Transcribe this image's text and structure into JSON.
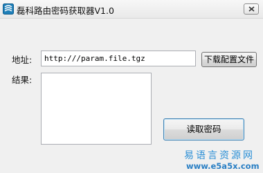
{
  "window": {
    "title": "磊科路由密码获取器V1.0"
  },
  "icons": {
    "app": "app-icon",
    "close": "close-icon"
  },
  "form": {
    "address_label": "地址:",
    "address_value": "http:///param.file.tgz",
    "download_button": "下载配置文件",
    "result_label": "结果:",
    "result_value": "",
    "read_button": "读取密码"
  },
  "watermark": {
    "site_name": "易语言资源网",
    "url": "www.e5a5x.com"
  },
  "colors": {
    "window_bg": "#f0f0f0",
    "accent": "#2b8fd6",
    "focus_border": "#3c7fb1"
  }
}
